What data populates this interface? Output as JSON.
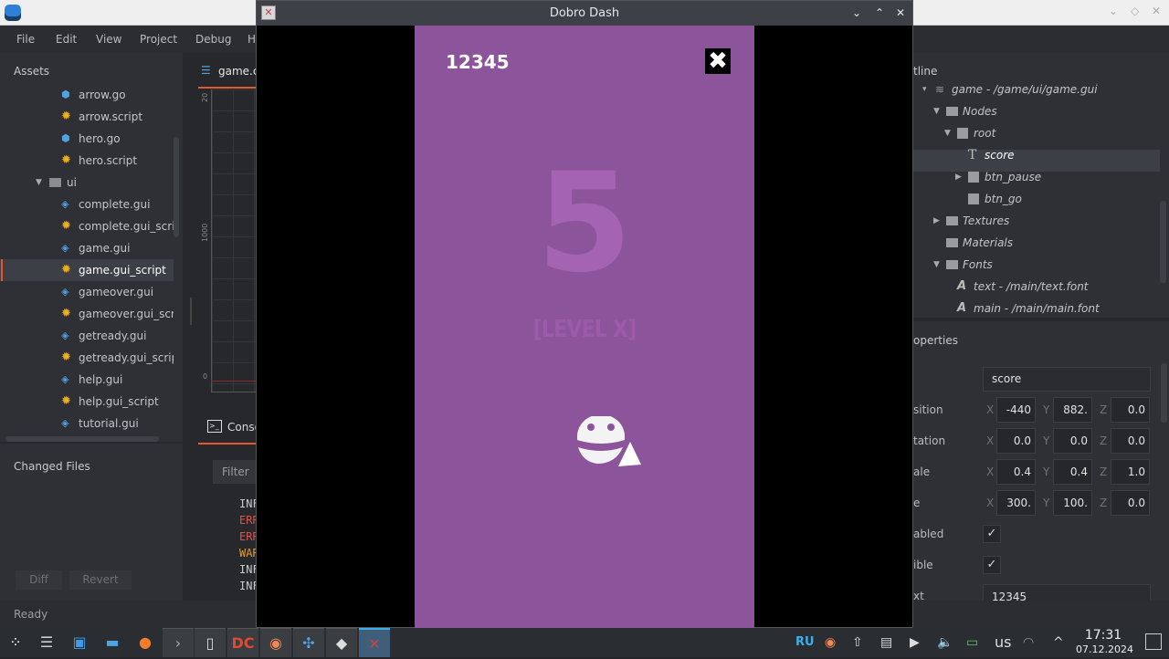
{
  "ide": {
    "menu": [
      "File",
      "Edit",
      "View",
      "Project",
      "Debug",
      "H"
    ],
    "assets_title": "Assets",
    "assets": [
      {
        "label": "arrow.go",
        "icon": "gameobject-icon"
      },
      {
        "label": "arrow.script",
        "icon": "script-gear-icon"
      },
      {
        "label": "hero.go",
        "icon": "gameobject-icon"
      },
      {
        "label": "hero.script",
        "icon": "script-gear-icon"
      },
      {
        "label": "ui",
        "icon": "folder-icon"
      },
      {
        "label": "complete.gui",
        "icon": "gui-icon"
      },
      {
        "label": "complete.gui_script",
        "icon": "script-gear-icon"
      },
      {
        "label": "game.gui",
        "icon": "gui-icon"
      },
      {
        "label": "game.gui_script",
        "icon": "script-gear-icon",
        "selected": true
      },
      {
        "label": "gameover.gui",
        "icon": "gui-icon"
      },
      {
        "label": "gameover.gui_script",
        "icon": "script-gear-icon"
      },
      {
        "label": "getready.gui",
        "icon": "gui-icon"
      },
      {
        "label": "getready.gui_script",
        "icon": "script-gear-icon"
      },
      {
        "label": "help.gui",
        "icon": "gui-icon"
      },
      {
        "label": "help.gui_script",
        "icon": "script-gear-icon"
      },
      {
        "label": "tutorial.gui",
        "icon": "gui-icon"
      }
    ],
    "changed_files_title": "Changed Files",
    "diff_label": "Diff",
    "revert_label": "Revert",
    "status": "Ready",
    "editor_tab": "game.c",
    "ruler": {
      "top": "20",
      "mid": "1000",
      "zero": "0"
    },
    "console_tab": "Conso",
    "filter_label": "Filter",
    "console_lines": [
      {
        "text": "INF",
        "color": "#c8c9cc"
      },
      {
        "text": "ERR",
        "color": "#d9534f"
      },
      {
        "text": "ERR",
        "color": "#d9534f"
      },
      {
        "text": "WAR",
        "color": "#e89a2c"
      },
      {
        "text": "INF",
        "color": "#c8c9cc"
      },
      {
        "text": "INF",
        "color": "#c8c9cc"
      }
    ],
    "outline_title": "tline",
    "outline": [
      {
        "label": "game - /game/ui/game.gui"
      },
      {
        "label": "Nodes"
      },
      {
        "label": "root"
      },
      {
        "label": "score",
        "selected": true
      },
      {
        "label": "btn_pause"
      },
      {
        "label": "btn_go"
      },
      {
        "label": "Textures"
      },
      {
        "label": "Materials"
      },
      {
        "label": "Fonts"
      },
      {
        "label": "text - /main/text.font"
      },
      {
        "label": "main - /main/main.font"
      }
    ],
    "properties_title": "operties",
    "properties": {
      "id": "score",
      "rows": [
        {
          "label": "sition",
          "x": "-440",
          "y": "882.",
          "z": "0.0"
        },
        {
          "label": "tation",
          "x": "0.0",
          "y": "0.0",
          "z": "0.0"
        },
        {
          "label": "ale",
          "x": "0.4",
          "y": "0.4",
          "z": "1.0"
        },
        {
          "label": "e",
          "x": "300.",
          "y": "100.",
          "z": "0.0"
        }
      ],
      "axis": {
        "x": "X",
        "y": "Y",
        "z": "Z"
      },
      "enabled_label": "abled",
      "visible_label": "ible",
      "text_label": "xt",
      "text_value": "12345",
      "check": "✓"
    }
  },
  "game": {
    "window_title": "Dobro Dash",
    "score": "12345",
    "countdown": "5",
    "level": "[LEVEL X]",
    "background": "#8c549a"
  },
  "taskbar": {
    "lang": "RU",
    "kbd": "us",
    "time": "17:31",
    "date": "07.12.2024"
  }
}
